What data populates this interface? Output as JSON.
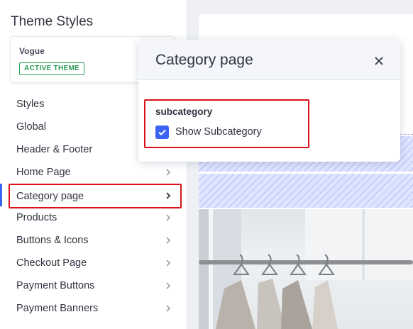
{
  "sidebar": {
    "title": "Theme Styles",
    "theme": {
      "name": "Vogue",
      "badge": "ACTIVE THEME"
    },
    "items": [
      {
        "label": "Styles"
      },
      {
        "label": "Global"
      },
      {
        "label": "Header & Footer"
      },
      {
        "label": "Home Page"
      },
      {
        "label": "Category page"
      },
      {
        "label": "Products"
      },
      {
        "label": "Buttons & Icons"
      },
      {
        "label": "Checkout Page"
      },
      {
        "label": "Payment Buttons"
      },
      {
        "label": "Payment Banners"
      }
    ],
    "active_item": "Category page"
  },
  "popover": {
    "title": "Category page",
    "close_icon": "close-icon",
    "section_title": "subcategory",
    "checkbox": {
      "label": "Show Subcategory",
      "checked": true
    }
  },
  "colors": {
    "accent": "#3c64f4",
    "highlight": "#d9121b",
    "badge_green": "#2c9b56",
    "hatch": "#dfe4ff"
  }
}
